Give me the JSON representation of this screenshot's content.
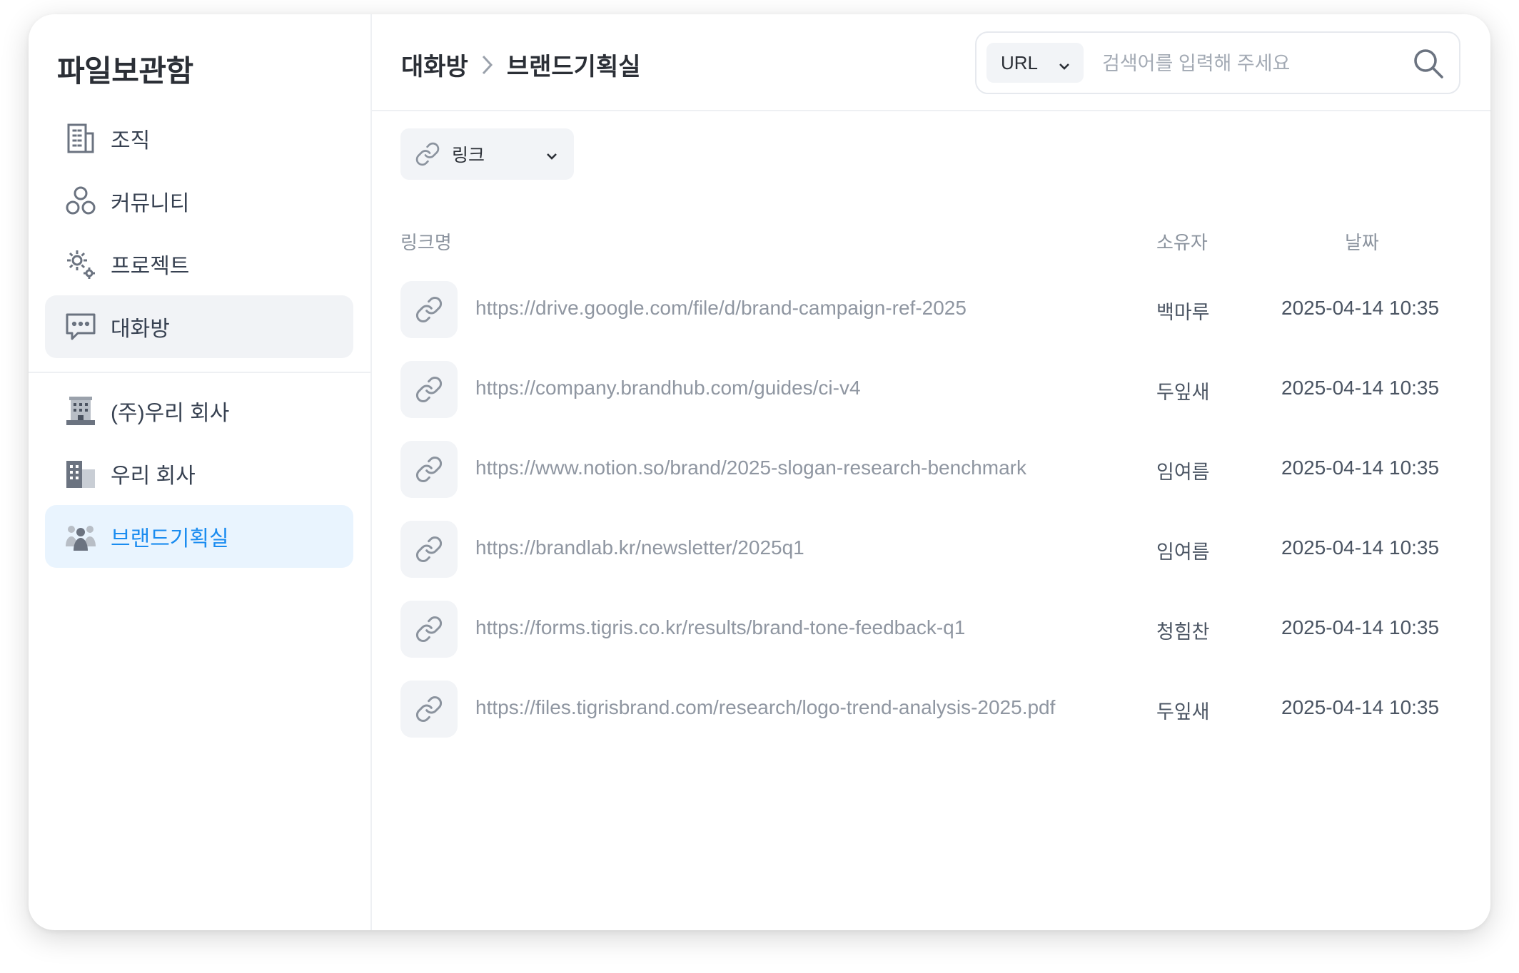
{
  "app": {
    "title": "파일보관함"
  },
  "sidebar": {
    "top_items": [
      {
        "label": "조직",
        "icon": "building-icon"
      },
      {
        "label": "커뮤니티",
        "icon": "community-icon"
      },
      {
        "label": "프로젝트",
        "icon": "gears-icon"
      },
      {
        "label": "대화방",
        "icon": "chat-icon",
        "active": true
      }
    ],
    "bottom_items": [
      {
        "label": "(주)우리 회사",
        "icon": "company-building-icon"
      },
      {
        "label": "우리 회사",
        "icon": "office-icon"
      },
      {
        "label": "브랜드기획실",
        "icon": "team-icon",
        "active": true
      }
    ]
  },
  "header": {
    "breadcrumb": [
      "대화방",
      "브랜드기획실"
    ],
    "search": {
      "type": "URL",
      "placeholder": "검색어를 입력해 주세요"
    }
  },
  "filter": {
    "label": "링크"
  },
  "table": {
    "columns": {
      "name": "링크명",
      "owner": "소유자",
      "date": "날짜"
    },
    "rows": [
      {
        "url": "https://drive.google.com/file/d/brand-campaign-ref-2025",
        "owner": "백마루",
        "date": "2025-04-14 10:35"
      },
      {
        "url": "https://company.brandhub.com/guides/ci-v4",
        "owner": "두잎새",
        "date": "2025-04-14 10:35"
      },
      {
        "url": "https://www.notion.so/brand/2025-slogan-research-benchmark",
        "owner": "임여름",
        "date": "2025-04-14 10:35"
      },
      {
        "url": "https://brandlab.kr/newsletter/2025q1",
        "owner": "임여름",
        "date": "2025-04-14 10:35"
      },
      {
        "url": "https://forms.tigris.co.kr/results/brand-tone-feedback-q1",
        "owner": "청힘찬",
        "date": "2025-04-14 10:35"
      },
      {
        "url": "https://files.tigrisbrand.com/research/logo-trend-analysis-2025.pdf",
        "owner": "두잎새",
        "date": "2025-04-14 10:35"
      }
    ]
  },
  "colors": {
    "accent": "#1a8cf0",
    "active_bg": "#e9f4fe",
    "icon": "#6b7380"
  }
}
